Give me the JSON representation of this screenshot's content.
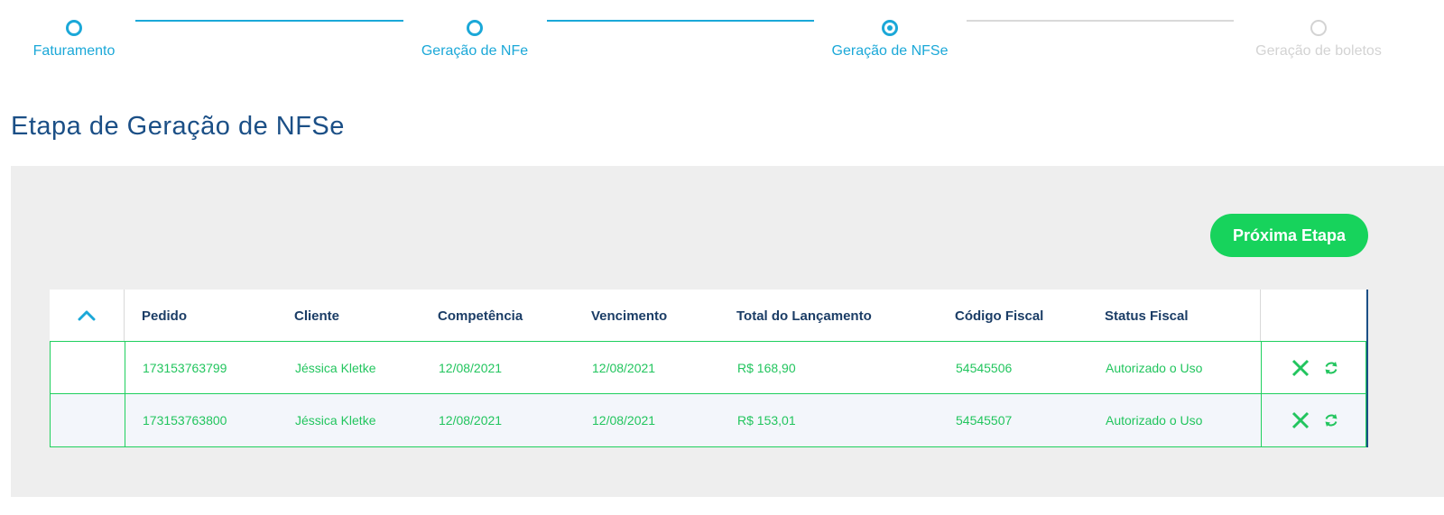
{
  "stepper": {
    "steps": [
      {
        "label": "Faturamento"
      },
      {
        "label": "Geração de NFe"
      },
      {
        "label": "Geração de NFSe"
      },
      {
        "label": "Geração de boletos"
      }
    ]
  },
  "page": {
    "title": "Etapa de Geração de NFSe"
  },
  "actions": {
    "next_label": "Próxima Etapa"
  },
  "table": {
    "headers": {
      "pedido": "Pedido",
      "cliente": "Cliente",
      "competencia": "Competência",
      "vencimento": "Vencimento",
      "total": "Total do Lançamento",
      "codigo": "Código Fiscal",
      "status": "Status Fiscal"
    },
    "rows": [
      {
        "pedido": "173153763799",
        "cliente": "Jéssica Kletke",
        "competencia": "12/08/2021",
        "vencimento": "12/08/2021",
        "total": "R$ 168,90",
        "codigo": "54545506",
        "status": "Autorizado o Uso"
      },
      {
        "pedido": "173153763800",
        "cliente": "Jéssica Kletke",
        "competencia": "12/08/2021",
        "vencimento": "12/08/2021",
        "total": "R$ 153,01",
        "codigo": "54545507",
        "status": "Autorizado o Uso"
      }
    ]
  },
  "colors": {
    "accent": "#1ba8d8",
    "title": "#1b4f86",
    "success": "#17d35c",
    "row_text": "#22c55e"
  },
  "icons": [
    "chevron-up-icon",
    "cancel-x-icon",
    "refresh-icon"
  ]
}
